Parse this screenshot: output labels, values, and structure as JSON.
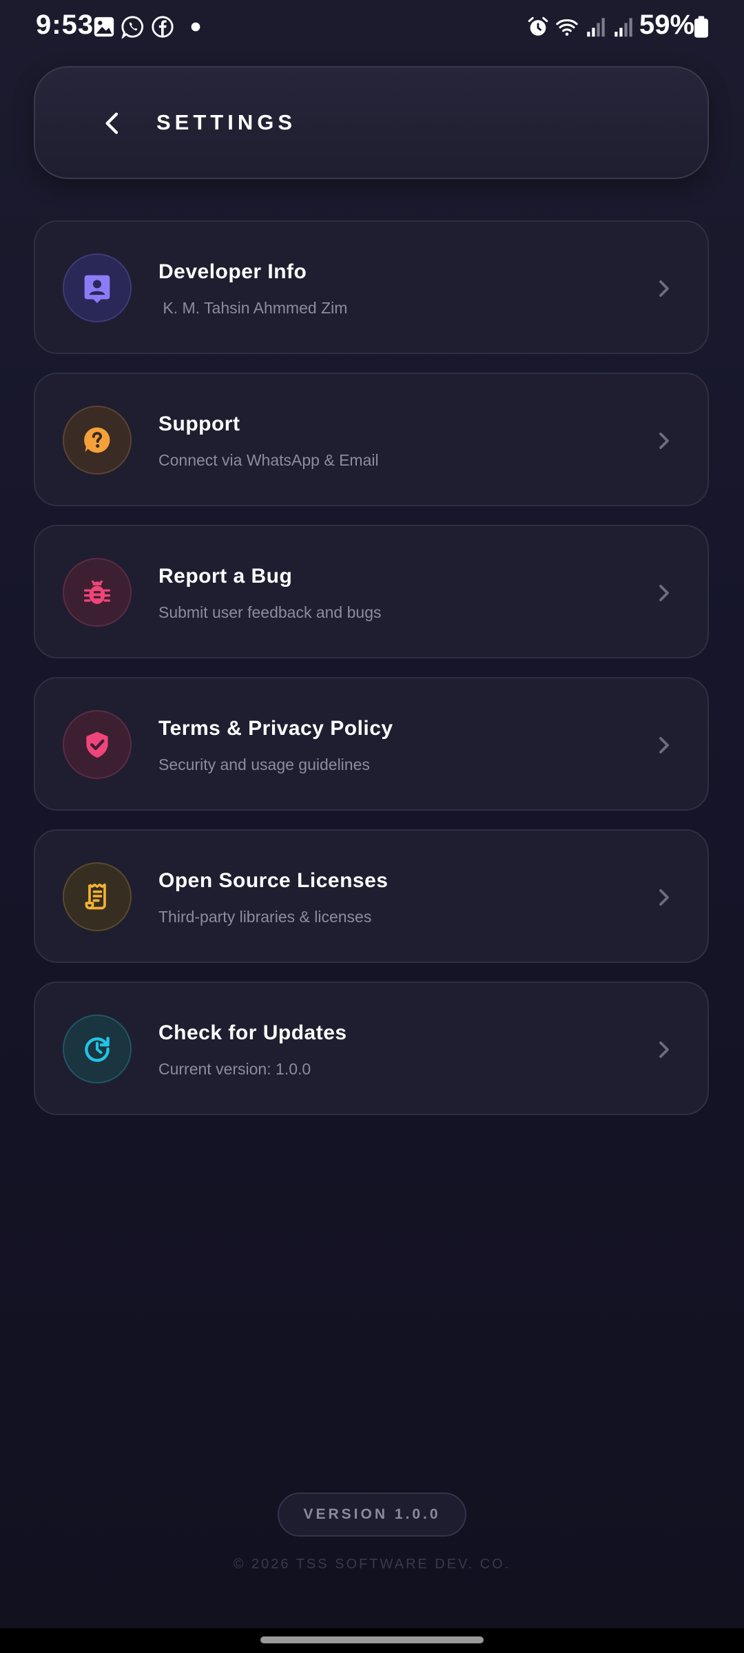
{
  "status_bar": {
    "time": "9:53",
    "battery": "59%"
  },
  "header": {
    "title": "SETTINGS"
  },
  "items": [
    {
      "title": "Developer Info",
      "subtitle": " K. M. Tahsin Ahmmed Zim",
      "icon": "contact-card-icon",
      "color": "#8b7cf6"
    },
    {
      "title": "Support",
      "subtitle": "Connect via WhatsApp & Email",
      "icon": "help-icon",
      "color": "#f5a13a"
    },
    {
      "title": "Report a Bug",
      "subtitle": "Submit user feedback and bugs",
      "icon": "bug-icon",
      "color": "#f0457a"
    },
    {
      "title": "Terms & Privacy Policy",
      "subtitle": "Security and usage guidelines",
      "icon": "shield-check-icon",
      "color": "#f0457a"
    },
    {
      "title": "Open Source Licenses",
      "subtitle": "Third-party libraries & licenses",
      "icon": "receipt-icon",
      "color": "#f2b233"
    },
    {
      "title": "Check for Updates",
      "subtitle": "Current version: 1.0.0",
      "icon": "update-icon",
      "color": "#22c3e6"
    }
  ],
  "footer": {
    "version": "VERSION 1.0.0",
    "copyright": "© 2026 TSS SOFTWARE DEV. CO."
  }
}
